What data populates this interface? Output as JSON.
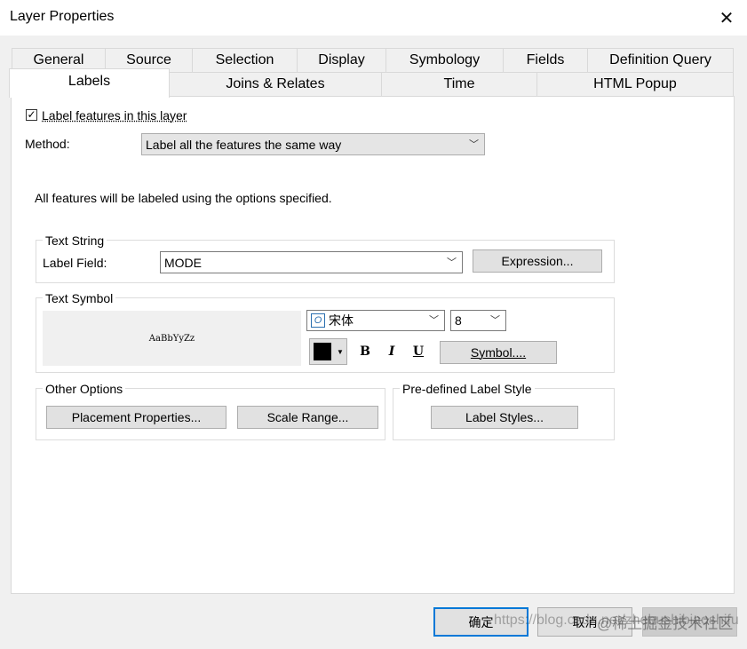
{
  "window": {
    "title": "Layer Properties"
  },
  "tabs_row1": [
    "General",
    "Source",
    "Selection",
    "Display",
    "Symbology",
    "Fields",
    "Definition Query"
  ],
  "tabs_row2": [
    "Labels",
    "Joins & Relates",
    "Time",
    "HTML Popup"
  ],
  "active_tab": "Labels",
  "labels_tab": {
    "label_features_checkbox": {
      "label": "Label features in this layer",
      "checked": true,
      "mark": "✓"
    },
    "method": {
      "label": "Method:",
      "value": "Label all the features the same way"
    },
    "info_text": "All features will be labeled using the options specified.",
    "text_string": {
      "title": "Text String",
      "label_field_label": "Label Field:",
      "label_field_value": "MODE",
      "expression_button": "Expression..."
    },
    "text_symbol": {
      "title": "Text Symbol",
      "preview_text": "AaBbYyZz",
      "font_value": "宋体",
      "size_value": "8",
      "color": "#000000",
      "bold": "B",
      "italic": "I",
      "underline": "U",
      "symbol_button": "Symbol...."
    },
    "other_options": {
      "title": "Other Options",
      "placement_button": "Placement Properties...",
      "scale_range_button": "Scale Range..."
    },
    "predefined_style": {
      "title": "Pre-defined Label Style",
      "label_styles_button": "Label Styles..."
    }
  },
  "footer": {
    "ok_button": "确定",
    "cancel_button": "取消",
    "apply_button": ""
  },
  "watermark": {
    "line1": "https://blog.csdn.net/zhebushibiaoshifu",
    "line2": "@稀土掘金技术社区"
  },
  "colors": {
    "accent_border": "#0078d7",
    "panel_bg": "#ffffff",
    "window_bg": "#f0f0f0"
  }
}
